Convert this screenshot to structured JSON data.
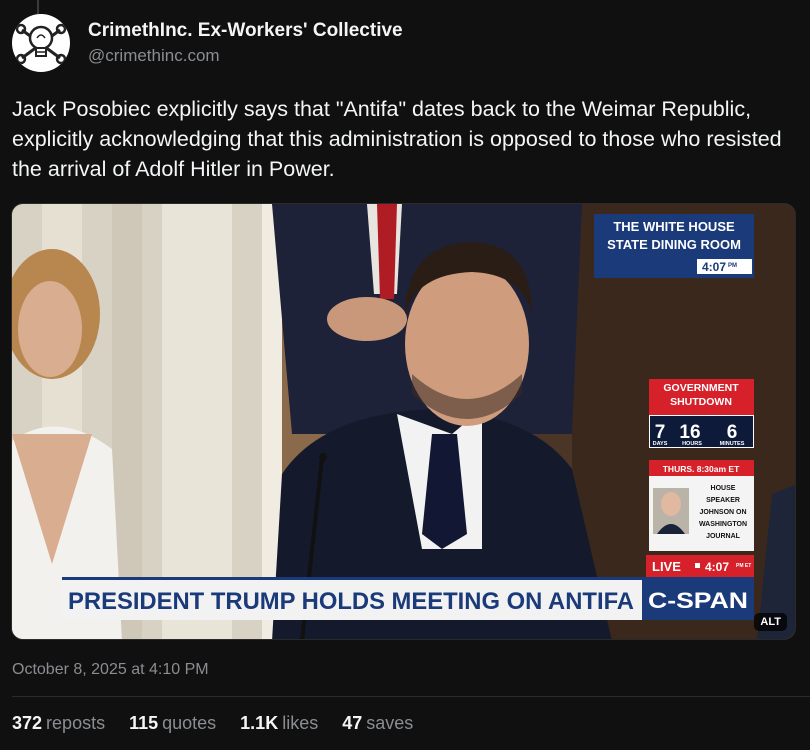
{
  "author": {
    "display_name": "CrimethInc. Ex-Workers' Collective",
    "handle": "@crimethinc.com",
    "avatar_icon": "lightbulb-wrench-logo-icon"
  },
  "post": {
    "text": "Jack Posobiec explicitly says that \"Antifa\" dates back to the Weimar Republic, explicitly acknowledging that this administration is opposed to those who resisted the arrival of Adolf Hitler in Power.",
    "timestamp": "October 8, 2025 at 4:10 PM"
  },
  "media": {
    "alt_label": "ALT",
    "overlay": {
      "location_line1": "THE WHITE HOUSE",
      "location_line2": "STATE DINING ROOM",
      "time": "4:07",
      "time_suffix": "PM",
      "shutdown_line1": "GOVERNMENT",
      "shutdown_line2": "SHUTDOWN",
      "counter_days": "7",
      "counter_hours": "16",
      "counter_minutes": "6",
      "label_days": "DAYS",
      "label_hours": "HOURS",
      "label_minutes": "MINUTES",
      "upcoming_header": "THURS. 8:30am ET",
      "upcoming_line1": "HOUSE",
      "upcoming_line2": "SPEAKER",
      "upcoming_line3": "JOHNSON ON",
      "upcoming_line4": "WASHINGTON",
      "upcoming_line5": "JOURNAL",
      "live_label": "LIVE",
      "live_time": "4:07",
      "live_tz": "PM ET",
      "headline": "PRESIDENT TRUMP HOLDS MEETING ON ANTIFA",
      "network": "C-SPAN"
    },
    "colors": {
      "cspan_blue": "#1a3a7a",
      "cspan_red": "#d6202a"
    }
  },
  "stats": {
    "reposts_count": "372",
    "reposts_label": "reposts",
    "quotes_count": "115",
    "quotes_label": "quotes",
    "likes_count": "1.1K",
    "likes_label": "likes",
    "saves_count": "47",
    "saves_label": "saves"
  }
}
